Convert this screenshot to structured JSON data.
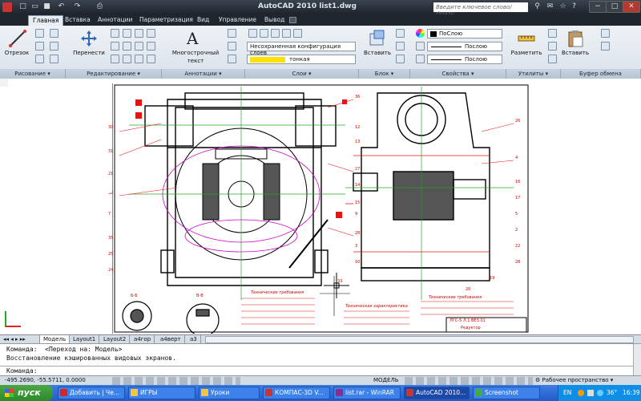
{
  "window": {
    "title": "AutoCAD 2010    list1.dwg",
    "search_placeholder": "Введите ключевое слово/фразу"
  },
  "ribbon_tabs": [
    "Главная",
    "Вставка",
    "Аннотации",
    "Параметризация",
    "Вид",
    "Управление",
    "Вывод"
  ],
  "ribbon": {
    "draw_tool": "Отрезок",
    "move_tool": "Перенести",
    "text_tool_line1": "Многострочный",
    "text_tool_line2": "текст",
    "layer_state": "Несохраненная конфигурация слоев",
    "layer_name": "тонкая",
    "insert_tool": "Вставить",
    "color_combo": "ПоСлою",
    "linetype_combo": "Послою",
    "lineweight_combo": "Послою",
    "measure_tool": "Разметить",
    "paste_tool": "Вставить",
    "panels": [
      "Рисование",
      "Редактирование",
      "Аннотации",
      "Слои",
      "Блок",
      "Свойства",
      "Утилиты",
      "Буфер обмена"
    ]
  },
  "drawing": {
    "title_block_code": "ЛГС-5 Л.1 ВЕЗ.01",
    "title_block_name": "Редуктор",
    "notes_title_1": "Технические требования",
    "notes_title_2": "Техническая характеристика",
    "notes_title_3": "Технические требования",
    "section_label_1": "Б-Б",
    "section_label_2": "В-В",
    "callouts": [
      "30",
      "31",
      "32",
      "36",
      "27",
      "28",
      "26",
      "4",
      "12",
      "13",
      "14",
      "15",
      "9",
      "3",
      "10",
      "16",
      "17",
      "5",
      "2",
      "22",
      "28",
      "19",
      "20",
      "21",
      "7",
      "35",
      "25",
      "24",
      "33"
    ]
  },
  "layout_tabs": [
    "Модель",
    "Layout1",
    "Layout2",
    "a4гор",
    "a4верт",
    "a3"
  ],
  "command_lines": [
    "Команда:  <Переход на: Модель>",
    "Восстановление кэшированных видовых экранов.",
    "",
    "Команда:"
  ],
  "status": {
    "coords": "-495.2690, -55.5711, 0.0000",
    "mode": "МОДЕЛЬ",
    "workspace": "Рабочее пространство"
  },
  "taskbar": {
    "start": "пуск",
    "tasks": [
      "Добавить | Че...",
      "ИГРЫ",
      "Уроки",
      "КОМПАС-3D V...",
      "list.rar - WinRAR",
      "AutoCAD 2010...",
      "Screenshot"
    ],
    "lang": "EN",
    "temp": "36°",
    "time": "16:39"
  }
}
